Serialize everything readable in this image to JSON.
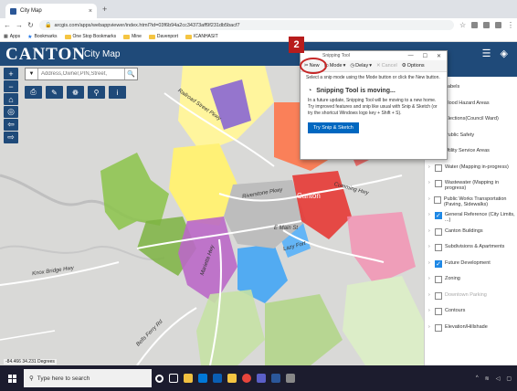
{
  "browser": {
    "tab_title": "City Map",
    "url": "arcgis.com/apps/webappviewer/index.html?id=03f6b94a2cc34373aff9f231db5bacf7",
    "bookmarks": [
      "Apps",
      "Bookmarks",
      "One Stop Bookmarks",
      "Mine",
      "Davenport",
      "ICANHASIT"
    ]
  },
  "app": {
    "logo": "CANTON",
    "title": "City Map",
    "search_placeholder": "Address,Owner,PIN,Street,",
    "coords": "-84.466 34.231 Degrees"
  },
  "map_labels": {
    "railroad": "Railroad Street Pkwy",
    "riverstone": "Riverstone Pkwy",
    "emain": "E Main St",
    "cumming": "Cumming Hwy",
    "marietta": "Marietta Hwy",
    "knox": "Knox Bridge Hwy",
    "bells": "Bells Ferry Rd",
    "canton": "Canton",
    "lazy": "Lazy Fort"
  },
  "snipping": {
    "title": "Snipping Tool",
    "new": "New",
    "mode": "Mode",
    "delay": "Delay",
    "cancel": "Cancel",
    "options": "Options",
    "message": "Select a snip mode using the Mode button or click the New button.",
    "info_title": "Snipping Tool is moving...",
    "info_body": "In a future update, Snipping Tool will be moving to a new home. Try improved features and snip like usual with Snip & Sketch (or try the shortcut Windows logo key + Shift + S).",
    "try_button": "Try Snip & Sketch"
  },
  "step_number": "2",
  "layers": [
    {
      "label": "Labels",
      "checked": false,
      "dim": false
    },
    {
      "label": "Flood Hazard Areas",
      "checked": false,
      "dim": false
    },
    {
      "label": "Elections(Council Ward)",
      "checked": false,
      "dim": false
    },
    {
      "label": "Public Safety",
      "checked": false,
      "dim": false
    },
    {
      "label": "Utility Service Areas",
      "checked": false,
      "dim": false
    },
    {
      "label": "Water (Mapping in-progress)",
      "checked": false,
      "dim": false
    },
    {
      "label": "Wastewater (Mapping in progress)",
      "checked": false,
      "dim": false
    },
    {
      "label": "Public Works Transportation (Paving, Sidewalks)",
      "checked": false,
      "dim": false
    },
    {
      "label": "General Reference (City Limits, ...)",
      "checked": true,
      "dim": false
    },
    {
      "label": "Canton Buildings",
      "checked": false,
      "dim": false
    },
    {
      "label": "Subdivisions & Apartments",
      "checked": false,
      "dim": false
    },
    {
      "label": "Future Development",
      "checked": true,
      "dim": false
    },
    {
      "label": "Zoning",
      "checked": false,
      "dim": false
    },
    {
      "label": "Downtown Parking",
      "checked": false,
      "dim": true
    },
    {
      "label": "Contours",
      "checked": false,
      "dim": false
    },
    {
      "label": "Elevation/Hillshade",
      "checked": false,
      "dim": false
    }
  ],
  "taskbar": {
    "search": "Type here to search"
  },
  "colors": {
    "header": "#1f4a79",
    "accent": "#b71c1c",
    "checked": "#1e88e5"
  }
}
